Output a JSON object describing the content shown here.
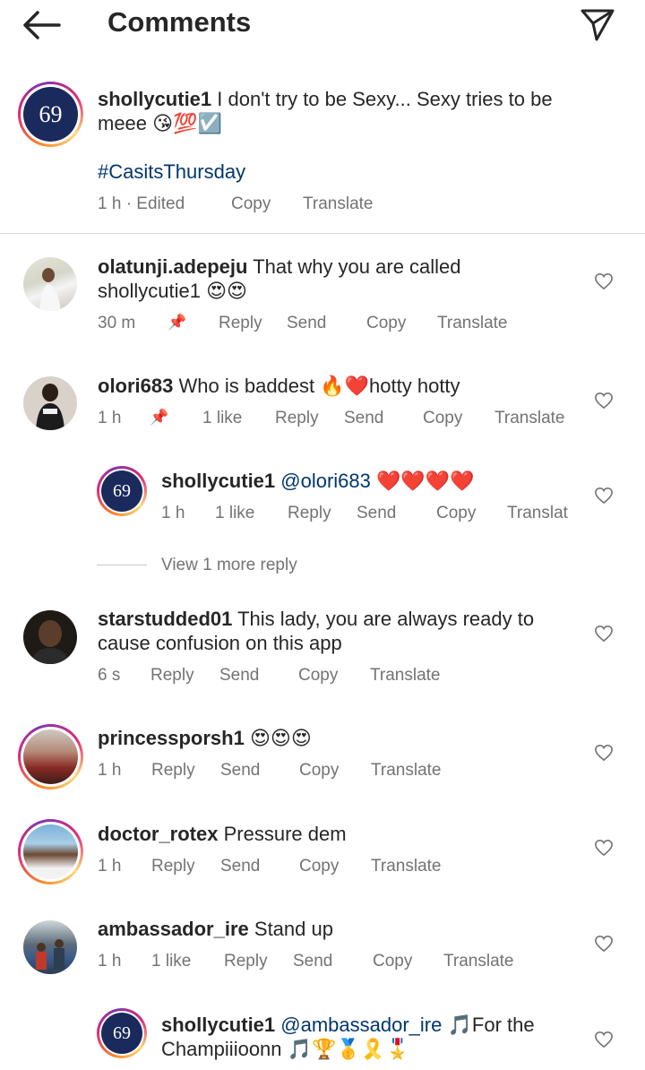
{
  "header": {
    "title": "Comments"
  },
  "caption": {
    "username": "shollycutie1",
    "text": "I don't try to be Sexy... Sexy tries to be meee 😘💯☑️",
    "hashtag": "#CasitsThursday",
    "time": "1 h · Edited",
    "copy": "Copy",
    "translate": "Translate",
    "avatar_text": "69"
  },
  "comments": [
    {
      "username": "olatunji.adepeju",
      "text": "That why you are called shollycutie1 😍😍",
      "time": "30 m",
      "pinned": true,
      "reply": "Reply",
      "send": "Send",
      "copy": "Copy",
      "translate": "Translate"
    },
    {
      "username": "olori683",
      "text": "Who is baddest 🔥❤️hotty hotty",
      "time": "1 h",
      "pinned": true,
      "likes": "1 like",
      "reply": "Reply",
      "send": "Send",
      "copy": "Copy",
      "translate": "Translate"
    },
    {
      "username": "shollycutie1",
      "mention": "@olori683",
      "text": "❤️❤️❤️❤️",
      "time": "1 h",
      "likes": "1 like",
      "reply": "Reply",
      "send": "Send",
      "copy": "Copy",
      "translate": "Translat",
      "avatar_text": "69"
    },
    {
      "username": "starstudded01",
      "text": "This lady, you are always ready to cause confusion on this app",
      "time": "6 s",
      "reply": "Reply",
      "send": "Send",
      "copy": "Copy",
      "translate": "Translate"
    },
    {
      "username": "princessporsh1",
      "text": "😍😍😍",
      "time": "1 h",
      "reply": "Reply",
      "send": "Send",
      "copy": "Copy",
      "translate": "Translate"
    },
    {
      "username": "doctor_rotex",
      "text": "Pressure dem",
      "time": "1 h",
      "reply": "Reply",
      "send": "Send",
      "copy": "Copy",
      "translate": "Translate"
    },
    {
      "username": "ambassador_ire",
      "text": "Stand up",
      "time": "1 h",
      "likes": "1 like",
      "reply": "Reply",
      "send": "Send",
      "copy": "Copy",
      "translate": "Translate"
    },
    {
      "username": "shollycutie1",
      "mention": "@ambassador_ire",
      "text": "🎵For the Champiiioonn 🎵🏆🥇🎗️🎖️",
      "avatar_text": "69"
    }
  ],
  "view_more": "View 1 more reply",
  "colors": {
    "link": "#00376b",
    "meta": "#737373",
    "avatar_bg": "#1b2a5c"
  },
  "icons": [
    "back-arrow-icon",
    "direct-send-icon",
    "heart-icon",
    "pin-icon"
  ]
}
